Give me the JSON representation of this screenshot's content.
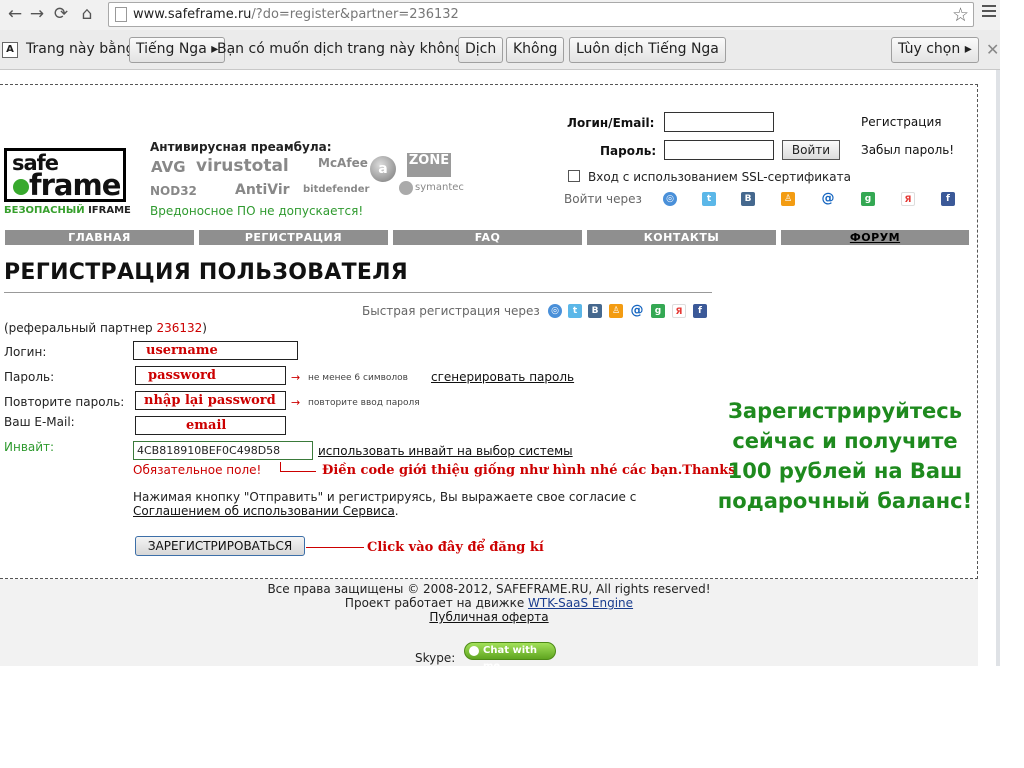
{
  "browser": {
    "url_host": "www.safeframe.ru",
    "url_path": "/?do=register&partner=236132"
  },
  "translate_bar": {
    "prefix": "Trang này bằng",
    "language": "Tiếng Nga ▸",
    "question": "Bạn có muốn dịch trang này không?",
    "translate_btn": "Dịch",
    "no_btn": "Không",
    "always_btn": "Luôn dịch Tiếng Nga",
    "options_btn": "Tùy chọn ▸"
  },
  "logo": {
    "safe": "safe",
    "frame": "frame",
    "tagline_green": "БЕЗОПАСНЫЙ",
    "tagline_black": " IFRAME"
  },
  "antivirus": {
    "title": "Антивирусная преамбула:",
    "brands": [
      "AVG",
      "virustotal",
      "McAfee",
      "NOD32",
      "AntiVir",
      "bitdefender",
      "ZONE",
      "symantec"
    ],
    "note": "Вредоносное ПО не допускается!"
  },
  "login": {
    "login_label": "Логин/Email:",
    "password_label": "Пароль:",
    "submit": "Войти",
    "register_link": "Регистрация",
    "forgot_link": "Забыл пароль!",
    "ssl_label": "Вход с использованием SSL-сертификата",
    "via_label": "Войти через"
  },
  "menu": [
    "ГЛАВНАЯ",
    "РЕГИСТРАЦИЯ",
    "FAQ",
    "КОНТАКТЫ",
    "ФОРУМ"
  ],
  "registration": {
    "title": "РЕГИСТРАЦИЯ ПОЛЬЗОВАТЕЛЯ",
    "quick_reg": "Быстрая регистрация через",
    "partner_prefix": "(реферальный партнер ",
    "partner_id": "236132",
    "partner_suffix": ")",
    "login_label": "Логин:",
    "password_label": "Пароль:",
    "repeat_label": "Повторите пароль:",
    "email_label": "Ваш E-Mail:",
    "invite_label": "Инвайт:",
    "invite_value": "4CB818910BEF0C498D58",
    "invite_link": "использовать инвайт на выбор системы",
    "arrow": "→",
    "password_hint": "не менее 6 символов",
    "generate_link": "сгенерировать пароль",
    "repeat_hint": "повторите ввод пароля",
    "required": "Обязательное поле!",
    "agree_line1": "Нажимая кнопку \"Отправить\" и регистрируясь, Вы выражаете свое согласие с",
    "agree_link": "Соглашением об использовании Сервиса",
    "agree_end": ".",
    "submit": "ЗАРЕГИСТРИРОВАТЬСЯ"
  },
  "annotations": {
    "username": "username",
    "password": "password",
    "repeat": "nhập lại password",
    "email": "email",
    "code": "Điền code giới thiệu giống như hình nhé các bạn.Thanks",
    "click": "Click vào đây để đăng kí"
  },
  "promo": {
    "line1": "Зарегистрируйтесь",
    "line2": "сейчас и получите",
    "line3": "100 рублей на Ваш",
    "line4": "подарочный баланс!"
  },
  "footer": {
    "copyright": "Все права защищены © 2008-2012, SAFEFRAME.RU, All rights reserved!",
    "engine_prefix": "Проект работает на движке ",
    "engine_link": "WTK-SaaS Engine",
    "offer": "Публичная оферта",
    "skype_label": "Skype:",
    "skype_btn": "Chat with me"
  },
  "colors": {
    "accent_green": "#1e8a1e",
    "annotation_red": "#cc0000",
    "menu_gray": "#8f8f8f"
  }
}
